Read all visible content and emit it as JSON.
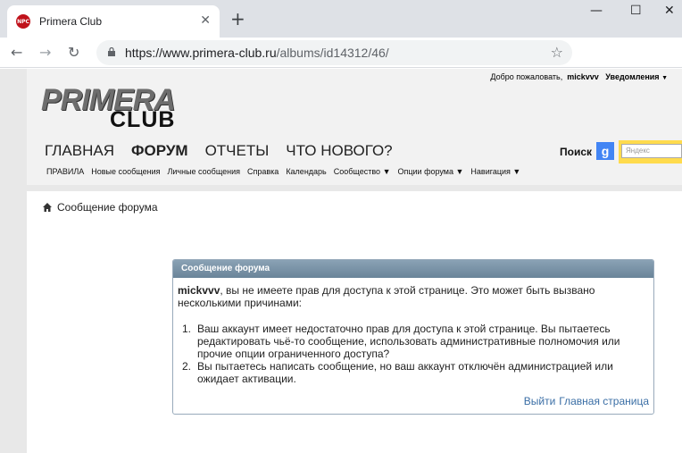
{
  "browser": {
    "tab_title": "Primera Club",
    "favicon_text": "NPC",
    "url_host": "https://www.primera-club.ru",
    "url_path": "/albums/id14312/46/"
  },
  "header": {
    "welcome_text": "Добро пожаловать,",
    "username": "mickvvv",
    "notifications": "Уведомления",
    "logo_line1": "PRIMERA",
    "logo_line2": "CLUB",
    "main_nav": [
      "ГЛАВНАЯ",
      "ФОРУМ",
      "ОТЧЕТЫ",
      "ЧТО НОВОГО?"
    ],
    "search_label": "Поиск",
    "yandex_placeholder": "Яндекс",
    "sub_nav": [
      "ПРАВИЛА",
      "Новые сообщения",
      "Личные сообщения",
      "Справка",
      "Календарь",
      "Сообщество",
      "Опции форума",
      "Навигация"
    ]
  },
  "breadcrumb": {
    "label": "Сообщение форума"
  },
  "message": {
    "title": "Сообщение форума",
    "username": "mickvvv",
    "intro": ", вы не имеете прав для доступа к этой странице. Это может быть вызвано несколькими причинами:",
    "reasons": [
      "Ваш аккаунт имеет недостаточно прав для доступа к этой странице. Вы пытаетесь редактировать чьё-то сообщение, использовать административные полномочия или прочие опции ограниченного доступа?",
      "Вы пытаетесь написать сообщение, но ваш аккаунт отключён администрацией или ожидает активации."
    ],
    "link_logout": "Выйти",
    "link_home": "Главная страница"
  },
  "colors": {
    "accent_link": "#3a6ea5",
    "box_header": "#7a93a7"
  }
}
